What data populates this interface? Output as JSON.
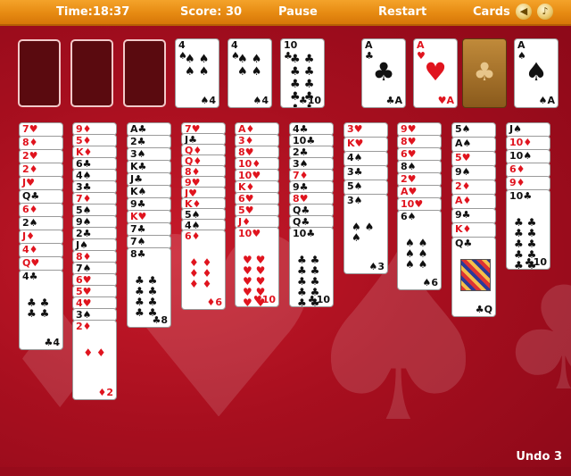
{
  "topbar": {
    "time_label": "Time:",
    "time_value": "18:37",
    "score_label": "Score:",
    "score_value": "30",
    "pause_label": "Pause",
    "restart_label": "Restart",
    "cards_label": "Cards",
    "icons": [
      "sound-icon",
      "music-icon"
    ]
  },
  "freecells": [
    {
      "rank": "4",
      "suit": "♠",
      "color": "black",
      "count": "4"
    },
    {
      "rank": "4",
      "suit": "♠",
      "color": "black",
      "count": "4"
    },
    {
      "rank": "10",
      "suit": "♣",
      "color": "black",
      "count": "10"
    }
  ],
  "foundations": [
    {
      "rank": "A",
      "suit": "♣",
      "color": "black"
    },
    {
      "rank": "A",
      "suit": "♥",
      "color": "red"
    },
    {
      "rank": "",
      "suit": "♣",
      "color": "back"
    },
    {
      "rank": "A",
      "suit": "♠",
      "color": "black"
    }
  ],
  "tableau": [
    {
      "cards": [
        {
          "r": "7",
          "s": "♥"
        },
        {
          "r": "8",
          "s": "♦"
        },
        {
          "r": "2",
          "s": "♥"
        },
        {
          "r": "2",
          "s": "♦"
        },
        {
          "r": "J",
          "s": "♥"
        },
        {
          "r": "Q",
          "s": "♣"
        },
        {
          "r": "6",
          "s": "♦"
        },
        {
          "r": "2",
          "s": "♠"
        },
        {
          "r": "J",
          "s": "♦"
        },
        {
          "r": "4",
          "s": "♦"
        },
        {
          "r": "Q",
          "s": "♥"
        },
        {
          "r": "4",
          "s": "♣"
        }
      ]
    },
    {
      "cards": [
        {
          "r": "9",
          "s": "♦"
        },
        {
          "r": "5",
          "s": "♦"
        },
        {
          "r": "K",
          "s": "♦"
        },
        {
          "r": "6",
          "s": "♣"
        },
        {
          "r": "4",
          "s": "♠"
        },
        {
          "r": "3",
          "s": "♣"
        },
        {
          "r": "7",
          "s": "♦"
        },
        {
          "r": "5",
          "s": "♠"
        },
        {
          "r": "9",
          "s": "♠"
        },
        {
          "r": "2",
          "s": "♣"
        },
        {
          "r": "J",
          "s": "♠"
        },
        {
          "r": "8",
          "s": "♦"
        },
        {
          "r": "7",
          "s": "♠"
        },
        {
          "r": "6",
          "s": "♥"
        },
        {
          "r": "5",
          "s": "♥"
        },
        {
          "r": "4",
          "s": "♥"
        },
        {
          "r": "3",
          "s": "♠"
        },
        {
          "r": "2",
          "s": "♦"
        }
      ]
    },
    {
      "cards": [
        {
          "r": "A",
          "s": "♣"
        },
        {
          "r": "2",
          "s": "♣"
        },
        {
          "r": "3",
          "s": "♠"
        },
        {
          "r": "K",
          "s": "♣"
        },
        {
          "r": "J",
          "s": "♣"
        },
        {
          "r": "K",
          "s": "♠"
        },
        {
          "r": "9",
          "s": "♣"
        },
        {
          "r": "K",
          "s": "♥"
        },
        {
          "r": "7",
          "s": "♣"
        },
        {
          "r": "7",
          "s": "♠"
        },
        {
          "r": "8",
          "s": "♣"
        }
      ]
    },
    {
      "cards": [
        {
          "r": "7",
          "s": "♥"
        },
        {
          "r": "J",
          "s": "♣"
        },
        {
          "r": "Q",
          "s": "♦"
        },
        {
          "r": "Q",
          "s": "♦"
        },
        {
          "r": "8",
          "s": "♦"
        },
        {
          "r": "9",
          "s": "♥"
        },
        {
          "r": "J",
          "s": "♥"
        },
        {
          "r": "K",
          "s": "♦"
        },
        {
          "r": "5",
          "s": "♠"
        },
        {
          "r": "4",
          "s": "♠"
        },
        {
          "r": "6",
          "s": "♦"
        }
      ]
    },
    {
      "cards": [
        {
          "r": "A",
          "s": "♦"
        },
        {
          "r": "3",
          "s": "♦"
        },
        {
          "r": "8",
          "s": "♥"
        },
        {
          "r": "10",
          "s": "♦"
        },
        {
          "r": "10",
          "s": "♥"
        },
        {
          "r": "K",
          "s": "♦"
        },
        {
          "r": "6",
          "s": "♥"
        },
        {
          "r": "5",
          "s": "♥"
        },
        {
          "r": "J",
          "s": "♦"
        },
        {
          "r": "10",
          "s": "♥"
        }
      ]
    },
    {
      "cards": [
        {
          "r": "4",
          "s": "♣"
        },
        {
          "r": "10",
          "s": "♣"
        },
        {
          "r": "2",
          "s": "♣"
        },
        {
          "r": "3",
          "s": "♠"
        },
        {
          "r": "7",
          "s": "♦"
        },
        {
          "r": "9",
          "s": "♣"
        },
        {
          "r": "8",
          "s": "♥"
        },
        {
          "r": "Q",
          "s": "♣"
        },
        {
          "r": "Q",
          "s": "♣"
        },
        {
          "r": "10",
          "s": "♣"
        }
      ]
    },
    {
      "cards": [
        {
          "r": "3",
          "s": "♥"
        },
        {
          "r": "K",
          "s": "♥"
        },
        {
          "r": "4",
          "s": "♠"
        },
        {
          "r": "3",
          "s": "♣"
        },
        {
          "r": "5",
          "s": "♠"
        },
        {
          "r": "3",
          "s": "♠"
        }
      ]
    },
    {
      "cards": [
        {
          "r": "9",
          "s": "♥"
        },
        {
          "r": "8",
          "s": "♥"
        },
        {
          "r": "6",
          "s": "♥"
        },
        {
          "r": "8",
          "s": "♠"
        },
        {
          "r": "2",
          "s": "♥"
        },
        {
          "r": "A",
          "s": "♥"
        },
        {
          "r": "10",
          "s": "♥"
        },
        {
          "r": "6",
          "s": "♠"
        }
      ]
    },
    {
      "cards": [
        {
          "r": "5",
          "s": "♠"
        },
        {
          "r": "A",
          "s": "♠"
        },
        {
          "r": "5",
          "s": "♥"
        },
        {
          "r": "9",
          "s": "♠"
        },
        {
          "r": "2",
          "s": "♦"
        },
        {
          "r": "A",
          "s": "♦"
        },
        {
          "r": "9",
          "s": "♣"
        },
        {
          "r": "K",
          "s": "♦"
        },
        {
          "r": "Q",
          "s": "♣"
        }
      ]
    },
    {
      "cards": [
        {
          "r": "J",
          "s": "♠"
        },
        {
          "r": "10",
          "s": "♦"
        },
        {
          "r": "10",
          "s": "♠"
        },
        {
          "r": "6",
          "s": "♦"
        },
        {
          "r": "9",
          "s": "♦"
        },
        {
          "r": "10",
          "s": "♣"
        }
      ]
    }
  ],
  "undo": {
    "label": "Undo",
    "count": "3"
  }
}
